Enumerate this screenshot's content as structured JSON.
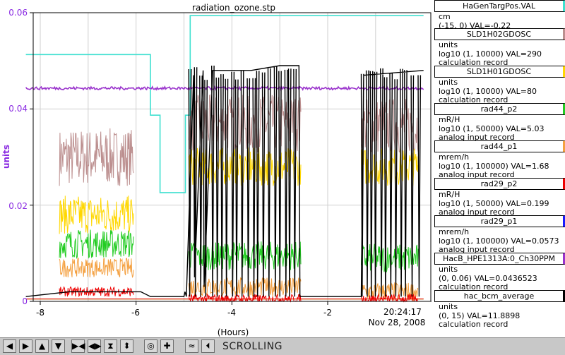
{
  "window": {
    "title": "radiation_ozone.stp"
  },
  "axis": {
    "y_label": "units",
    "y_ticks": [
      "0.06",
      "0.04",
      "0.02",
      "0"
    ],
    "x_ticks": [
      "-8",
      "-6",
      "-4",
      "-2"
    ],
    "x_label": "(Hours)",
    "time": "20:24:17",
    "date": "Nov 28, 2008"
  },
  "legend": [
    {
      "name": "HaGenTargPos.VAL",
      "color": "#40e0d0",
      "lines": [
        "cm",
        "(-15, 0) VAL=-0.22"
      ]
    },
    {
      "name": "SLD1H02GDOSC",
      "color": "#bc8f8f",
      "lines": [
        "units",
        "log10 (1, 10000) VAL=290",
        "calculation record"
      ]
    },
    {
      "name": "SLD1H01GDOSC",
      "color": "#ffd700",
      "lines": [
        "units",
        "log10 (1, 10000) VAL=80",
        "calculation record"
      ]
    },
    {
      "name": "rad44_p2",
      "color": "#22cc22",
      "lines": [
        "mR/H",
        "log10 (1, 50000) VAL=5.03",
        "analog input record"
      ]
    },
    {
      "name": "rad44_p1",
      "color": "#f4a040",
      "lines": [
        "mrem/h",
        "log10 (1, 100000) VAL=1.68",
        "analog input record"
      ]
    },
    {
      "name": "rad29_p2",
      "color": "#ee0000",
      "lines": [
        "mR/H",
        "log10 (1, 50000) VAL=0.199",
        "analog input record"
      ]
    },
    {
      "name": "rad29_p1",
      "color": "#1a1aff",
      "lines": [
        "mrem/h",
        "log10 (1, 100000) VAL=0.0573",
        "analog input record"
      ]
    },
    {
      "name": "HacB_HPE1313A:0_Ch30PPM",
      "color": "#9932cc",
      "lines": [
        "units",
        "(0, 0.06) VAL=0.0436523",
        "calculation record"
      ]
    },
    {
      "name": "hac_bcm_average",
      "color": "#000000",
      "lines": [
        "units",
        "(0, 15) VAL=11.8898",
        "calculation record"
      ]
    }
  ],
  "toolbar": {
    "buttons": [
      {
        "name": "pan-left-button",
        "icon": "◀"
      },
      {
        "name": "pan-right-button",
        "icon": "▶"
      },
      {
        "name": "pan-up-button",
        "icon": "▲"
      },
      {
        "name": "pan-down-button",
        "icon": "▼"
      },
      {
        "name": "zoom-in-x-button",
        "icon": "▶◀"
      },
      {
        "name": "zoom-out-x-button",
        "icon": "◀▶"
      },
      {
        "name": "zoom-in-y-button",
        "icon": "⧗"
      },
      {
        "name": "zoom-out-y-button",
        "icon": "⬍"
      },
      {
        "name": "auto-scale-button",
        "icon": "◎"
      },
      {
        "name": "add-cursor-button",
        "icon": "✚"
      },
      {
        "name": "stagger-button",
        "icon": "≈"
      },
      {
        "name": "scroll-button",
        "icon": "⏴"
      }
    ],
    "status": "SCROLLING"
  },
  "chart_data": {
    "type": "line",
    "title": "radiation_ozone.stp",
    "xlabel": "(Hours)",
    "ylabel": "units",
    "xlim": [
      -8.3,
      0
    ],
    "ylim": [
      0,
      0.06
    ],
    "grid": true,
    "legend_position": "right",
    "series": [
      {
        "name": "HaGenTargPos.VAL",
        "color": "#40e0d0",
        "x": [
          -8.3,
          -5.7,
          -5.7,
          -5.5,
          -5.5,
          -4.97,
          -4.97,
          -4.87,
          -4.87,
          0
        ],
        "y": [
          0.0513,
          0.0513,
          0.0387,
          0.0387,
          0.0226,
          0.0226,
          0.0387,
          0.0387,
          0.0594,
          0.0594
        ]
      },
      {
        "name": "HacB_HPE1313A:0_Ch30PPM",
        "color": "#9932cc",
        "x": [
          -8.3,
          -6.0,
          -4.0,
          -2.0,
          0
        ],
        "y": [
          0.0444,
          0.0443,
          0.0442,
          0.0442,
          0.0443
        ]
      },
      {
        "name": "hac_bcm_average",
        "color": "#000000",
        "x": [
          -8.3,
          -7.4,
          -7.2,
          -6.1,
          -5.9,
          -5.7,
          -5.0,
          -4.98,
          -4.95,
          -4.8,
          -4.78,
          -4.6,
          -4.58,
          -4.4,
          -4.38,
          -3.6,
          -3.0,
          -2.6,
          -2.58,
          -2.2,
          -1.3,
          -1.25,
          0
        ],
        "y": [
          0.001,
          0.002,
          0.002,
          0.002,
          0.002,
          0.001,
          0.001,
          0.002,
          0.001,
          0.047,
          0.005,
          0.048,
          0.003,
          0.048,
          0.048,
          0.048,
          0.049,
          0.049,
          0.001,
          0.001,
          0.001,
          0.047,
          0.048
        ]
      }
    ]
  }
}
